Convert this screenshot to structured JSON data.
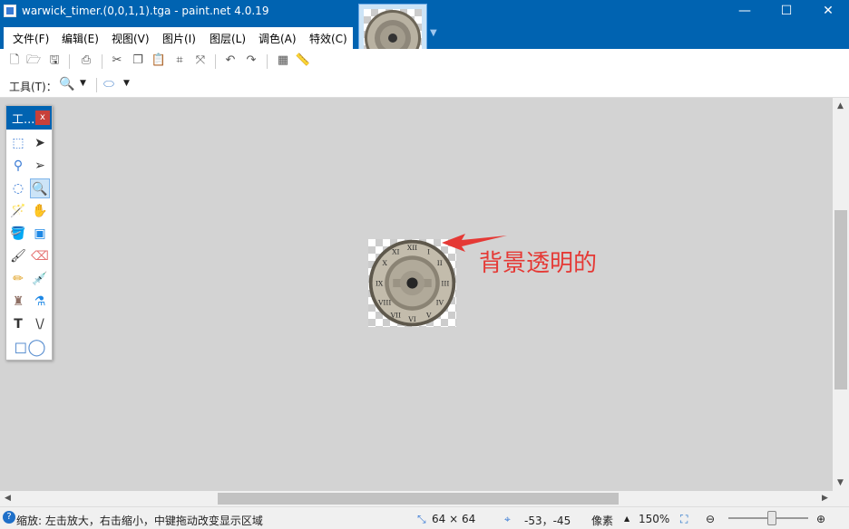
{
  "window": {
    "title": "warwick_timer.(0,0,1,1).tga - paint.net 4.0.19",
    "minimize": "—",
    "maximize": "☐",
    "close": "✕"
  },
  "menu": {
    "items": [
      "文件(F)",
      "编辑(E)",
      "视图(V)",
      "图片(I)",
      "图层(L)",
      "调色(A)",
      "特效(C)"
    ]
  },
  "tool_row": {
    "tool_label": "工具(T)："
  },
  "tool_panel": {
    "title": "工...",
    "close": "x",
    "selected_tool": "zoom-tool"
  },
  "annotation": {
    "text": "背景透明的",
    "color": "#e53935"
  },
  "status": {
    "hint": "缩放: 左击放大，右击缩小，中键拖动改变显示区域",
    "image_size": "64 × 64",
    "cursor_pos": "-53，-45",
    "unit": "像素",
    "zoom": "150%"
  },
  "colors": {
    "accent": "#0063b1",
    "canvas": "#d3d3d3"
  }
}
